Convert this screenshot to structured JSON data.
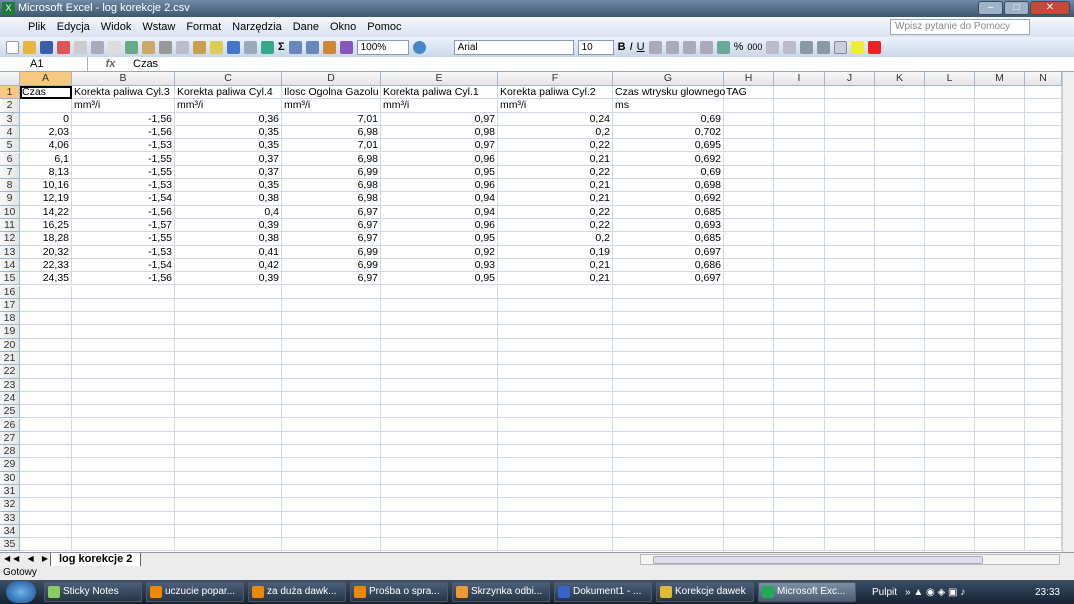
{
  "window": {
    "title": "Microsoft Excel - log korekcje 2.csv"
  },
  "menu": [
    "Plik",
    "Edycja",
    "Widok",
    "Wstaw",
    "Format",
    "Narzędzia",
    "Dane",
    "Okno",
    "Pomoc"
  ],
  "help_placeholder": "Wpisz pytanie do Pomocy",
  "toolbar": {
    "zoom": "100%",
    "font": "Arial",
    "size": "10",
    "bold": "B",
    "italic": "I",
    "underline": "U",
    "sigma": "Σ",
    "percent": "%",
    "thousands": "000"
  },
  "formula": {
    "name_box": "A1",
    "fx": "fx",
    "value": "Czas"
  },
  "columns": [
    "A",
    "B",
    "C",
    "D",
    "E",
    "F",
    "G",
    "H",
    "I",
    "J",
    "K",
    "L",
    "M",
    "N"
  ],
  "rows": [
    [
      "Czas",
      "Korekta paliwa Cyl.3",
      "Korekta paliwa Cyl.4",
      "Ilosc Ogolna Gazolu",
      "Korekta paliwa Cyl.1",
      "Korekta paliwa Cyl.2",
      "Czas wtrysku glownego",
      "TAG"
    ],
    [
      "",
      "mm³/i",
      "mm³/i",
      "mm³/i",
      "mm³/i",
      "mm³/i",
      "ms",
      ""
    ],
    [
      "0",
      "-1,56",
      "0,36",
      "7,01",
      "0,97",
      "0,24",
      "0,69"
    ],
    [
      "2,03",
      "-1,56",
      "0,35",
      "6,98",
      "0,98",
      "0,2",
      "0,702"
    ],
    [
      "4,06",
      "-1,53",
      "0,35",
      "7,01",
      "0,97",
      "0,22",
      "0,695"
    ],
    [
      "6,1",
      "-1,55",
      "0,37",
      "6,98",
      "0,96",
      "0,21",
      "0,692"
    ],
    [
      "8,13",
      "-1,55",
      "0,37",
      "6,99",
      "0,95",
      "0,22",
      "0,69"
    ],
    [
      "10,16",
      "-1,53",
      "0,35",
      "6,98",
      "0,96",
      "0,21",
      "0,698"
    ],
    [
      "12,19",
      "-1,54",
      "0,38",
      "6,98",
      "0,94",
      "0,21",
      "0,692"
    ],
    [
      "14,22",
      "-1,56",
      "0,4",
      "6,97",
      "0,94",
      "0,22",
      "0,685"
    ],
    [
      "16,25",
      "-1,57",
      "0,39",
      "6,97",
      "0,96",
      "0,22",
      "0,693"
    ],
    [
      "18,28",
      "-1,55",
      "0,38",
      "6,97",
      "0,95",
      "0,2",
      "0,685"
    ],
    [
      "20,32",
      "-1,53",
      "0,41",
      "6,99",
      "0,92",
      "0,19",
      "0,697"
    ],
    [
      "22,33",
      "-1,54",
      "0,42",
      "6,99",
      "0,93",
      "0,21",
      "0,686"
    ],
    [
      "24,35",
      "-1,56",
      "0,39",
      "6,97",
      "0,95",
      "0,21",
      "0,697"
    ]
  ],
  "row_count": 35,
  "sheet_tab": "log korekcje 2",
  "status": "Gotowy",
  "taskbar": {
    "items": [
      "Sticky Notes",
      "uczucie popar...",
      "za duża dawk...",
      "Prośba o spra...",
      "Skrzynka odbi...",
      "Dokument1 - ...",
      "Korekcje dawek",
      "Microsoft Exc..."
    ],
    "desktop": "Pulpit",
    "clock": "23:33"
  }
}
